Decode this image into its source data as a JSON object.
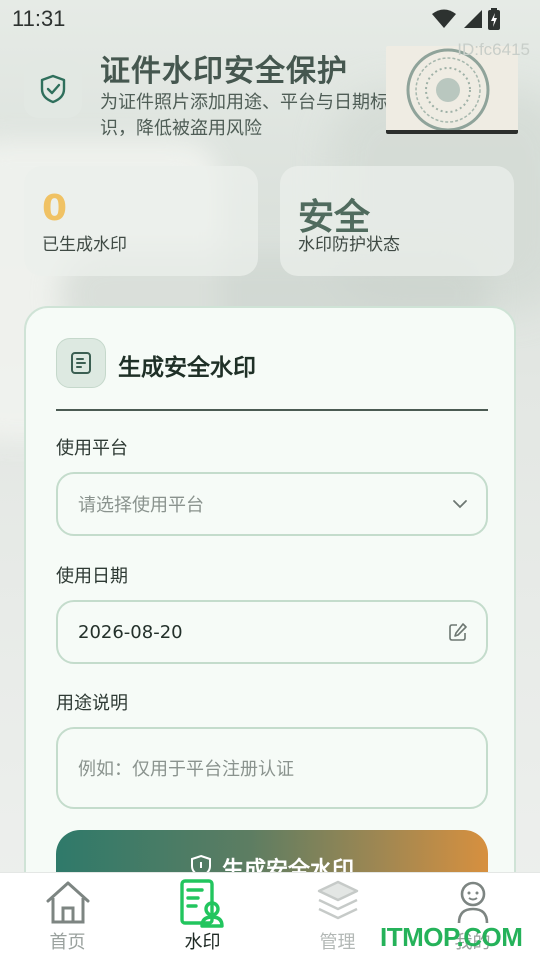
{
  "status_bar": {
    "time": "11:31"
  },
  "watermark_id": "ID:fc6415",
  "header": {
    "title": "证件水印安全保护",
    "subtitle": "为证件照片添加用途、平台与日期标识，降低被盗用风险"
  },
  "stats": [
    {
      "value": "0",
      "label": "已生成水印",
      "color": "#f0c264"
    },
    {
      "value": "安全",
      "label": "水印防护状态",
      "color": "#506b5e"
    }
  ],
  "form": {
    "title": "生成安全水印",
    "platform": {
      "label": "使用平台",
      "placeholder": "请选择使用平台"
    },
    "date": {
      "label": "使用日期",
      "value": "2026-08-20"
    },
    "purpose": {
      "label": "用途说明",
      "placeholder": "例如：仅用于平台注册认证"
    },
    "generate_button": "生成安全水印"
  },
  "nav": {
    "active_color": "#22c55e",
    "items": [
      {
        "label": "首页",
        "icon": "home-icon"
      },
      {
        "label": "水印",
        "icon": "id-card-icon"
      },
      {
        "label": "管理",
        "icon": "layers-icon"
      },
      {
        "label": "我的",
        "icon": "person-icon"
      }
    ]
  },
  "brand": "ITMOP.COM"
}
